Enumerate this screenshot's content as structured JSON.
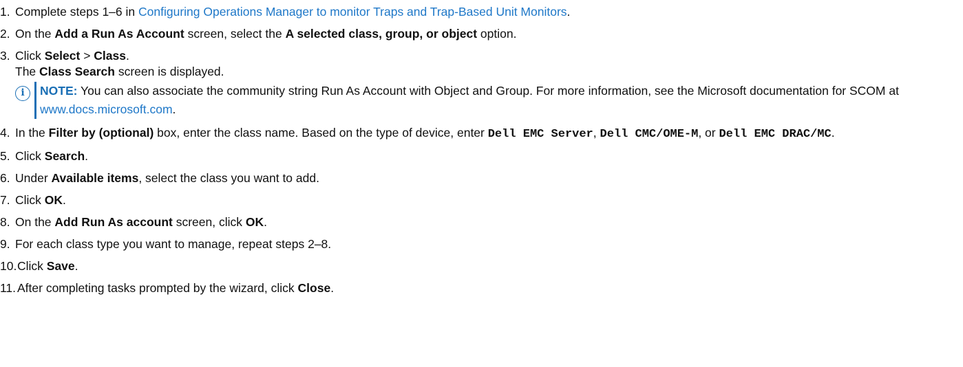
{
  "steps": [
    {
      "num": "1.",
      "pre": "Complete steps 1–6 in ",
      "link": "Configuring Operations Manager to monitor Traps and Trap-Based Unit Monitors",
      "post": "."
    },
    {
      "num": "2.",
      "t1": "On the ",
      "b1": "Add a Run As Account",
      "t2": " screen, select the ",
      "b2": "A selected class, group, or object",
      "t3": " option."
    },
    {
      "num": "3.",
      "t1": "Click ",
      "b1": "Select",
      "t2": " > ",
      "b2": "Class",
      "t3": ".",
      "line2_pre": "The ",
      "line2_bold": "Class Search",
      "line2_post": " screen is displayed.",
      "note": {
        "icon": "info-icon",
        "label": "NOTE:",
        "text": " You can also associate the community string Run As Account with Object and Group. For more information, see the Microsoft documentation for SCOM at ",
        "link": "www.docs.microsoft.com",
        "post": "."
      }
    },
    {
      "num": "4.",
      "t1": "In the ",
      "b1": "Filter by (optional)",
      "t2": " box, enter the class name. Based on the type of device, enter ",
      "m1": "Dell EMC Server",
      "t3": ", ",
      "m2": "Dell CMC/OME-M",
      "t4": ", or ",
      "m3": "Dell EMC DRAC/MC",
      "t5": "."
    },
    {
      "num": "5.",
      "t1": "Click ",
      "b1": "Search",
      "t2": "."
    },
    {
      "num": "6.",
      "t1": "Under ",
      "b1": "Available items",
      "t2": ", select the class you want to add."
    },
    {
      "num": "7.",
      "t1": "Click ",
      "b1": "OK",
      "t2": "."
    },
    {
      "num": "8.",
      "t1": "On the ",
      "b1": "Add Run As account",
      "t2": " screen, click ",
      "b2": "OK",
      "t3": "."
    },
    {
      "num": "9.",
      "t1": "For each class type you want to manage, repeat steps 2–8."
    },
    {
      "num": "10.",
      "t1": "Click ",
      "b1": "Save",
      "t2": "."
    },
    {
      "num": "11.",
      "t1": "After completing tasks prompted by the wizard, click ",
      "b1": "Close",
      "t2": "."
    }
  ]
}
